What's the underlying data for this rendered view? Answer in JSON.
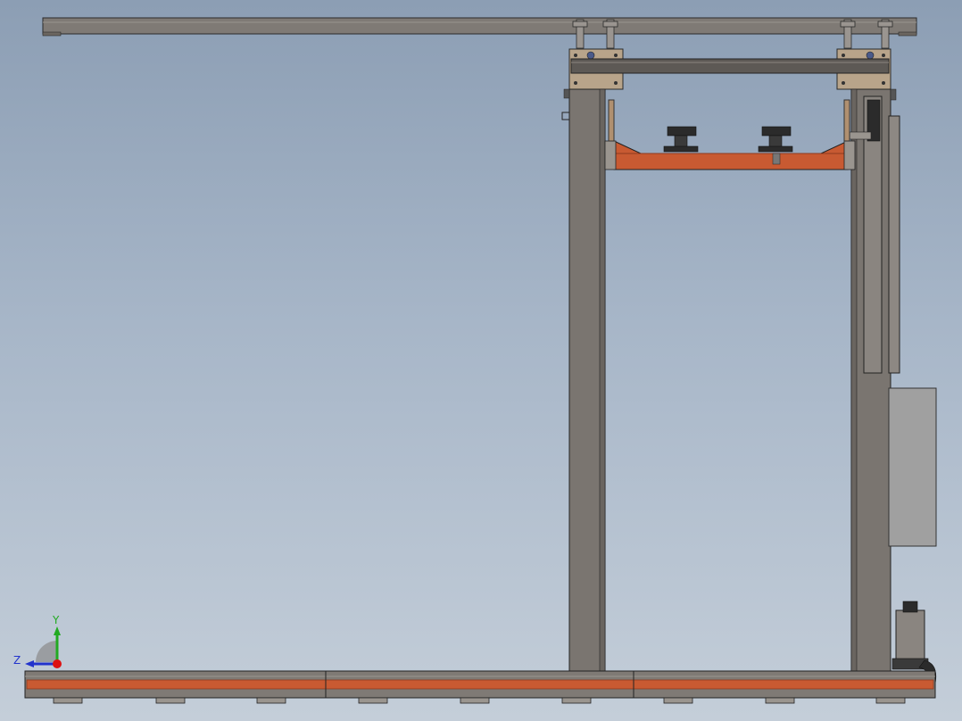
{
  "viewport": {
    "background_top": "#8c9eb4",
    "background_bottom": "#c4ced9"
  },
  "model": {
    "steel_color": "#7a7570",
    "rail_color": "#c85a32",
    "bracket_color": "#b8a48a",
    "dark_part_color": "#2b2b2b",
    "panel_color": "#a0a0a0"
  },
  "triad": {
    "y_label": "Y",
    "z_label": "Z",
    "y_color": "#22aa22",
    "z_color": "#2233cc",
    "x_color": "#dd1111",
    "icon": "view-orientation-triad-icon"
  }
}
